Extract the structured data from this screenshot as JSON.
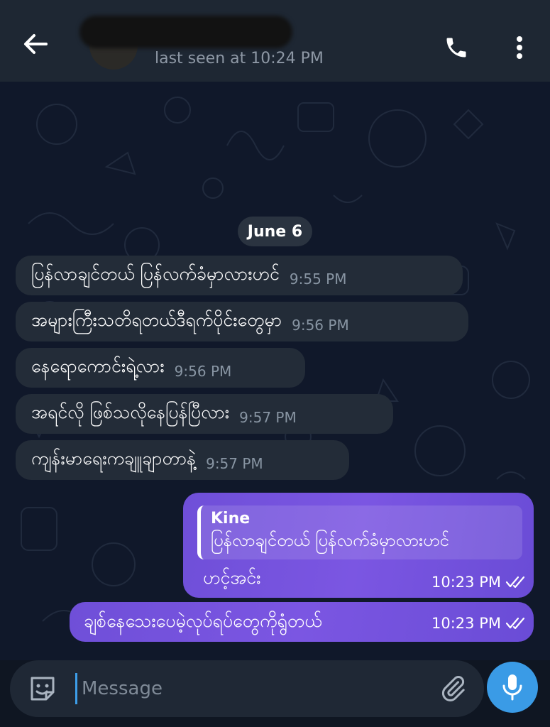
{
  "header": {
    "status": "last seen at 10:24 PM",
    "icons": {
      "back": "arrow-left-icon",
      "call": "phone-icon",
      "more": "more-vertical-icon"
    }
  },
  "chat": {
    "date_chip": "June 6",
    "incoming": [
      {
        "text": "ပြန်လာချင်တယ် ပြန်လက်ခံမှာလားဟင်",
        "time": "9:55 PM"
      },
      {
        "text": "အများကြီးသတိရတယ်ဒီရက်ပိုင်းတွေမှာ",
        "time": "9:56 PM"
      },
      {
        "text": "နေရောကောင်းရဲ့လား",
        "time": "9:56 PM"
      },
      {
        "text": "အရင်လို ဖြစ်သလိုနေပြန်ပြီလား",
        "time": "9:57 PM"
      },
      {
        "text": "ကျန်းမာရေးကချူချာတာနဲ့",
        "time": "9:57 PM"
      }
    ],
    "outgoing": [
      {
        "reply_name": "Kine",
        "reply_text": "ပြန်လာချင်တယ် ပြန်လက်ခံမှာလားဟင်",
        "text": "ဟင့်အင်း",
        "time": "10:23 PM"
      },
      {
        "text": "ချစ်နေသေးပေမဲ့လုပ်ရပ်တွေကိုရွံတယ်",
        "time": "10:23 PM"
      }
    ],
    "status_icon": "double-check-icon"
  },
  "composer": {
    "placeholder": "Message",
    "icons": {
      "sticker": "sticker-icon",
      "attach": "paperclip-icon",
      "mic": "microphone-icon"
    }
  },
  "colors": {
    "header_bg": "#1e2733",
    "chat_bg": "#10182a",
    "incoming_bubble": "#232c38",
    "outgoing_bubble": "#7052dd",
    "mic_button": "#3a9be6"
  }
}
